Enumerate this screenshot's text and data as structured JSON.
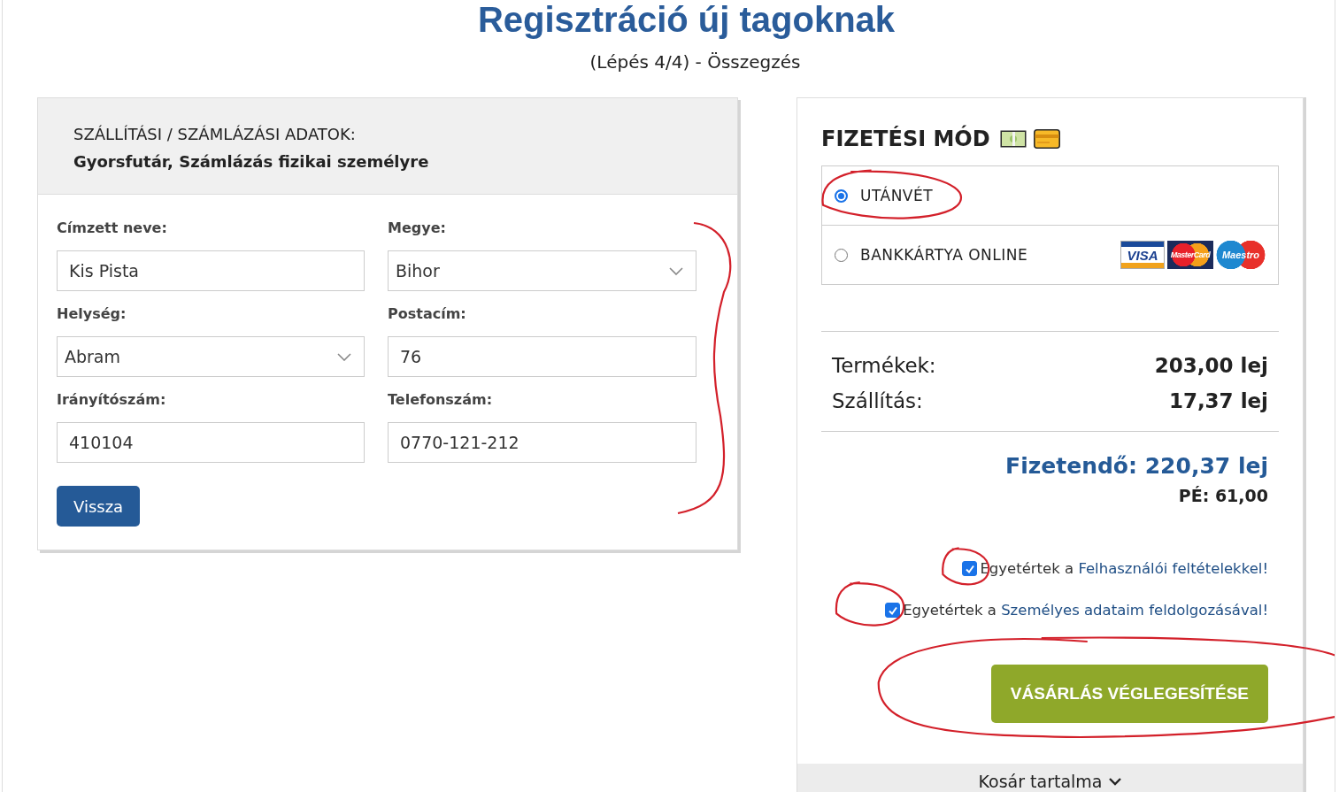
{
  "header": {
    "title": "Regisztráció új tagoknak",
    "subtitle": "(Lépés 4/4) - Összegzés"
  },
  "shipping": {
    "heading": "SZÁLLÍTÁSI / SZÁMLÁZÁSI ADATOK:",
    "summary": "Gyorsfutár, Számlázás fizikai személyre",
    "fields": [
      {
        "label": "Címzett neve:",
        "kind": "text",
        "value": "Kis Pista"
      },
      {
        "label": "Megye:",
        "kind": "select",
        "value": "Bihor"
      },
      {
        "label": "Helység:",
        "kind": "select",
        "value": "Abram"
      },
      {
        "label": "Postacím:",
        "kind": "text",
        "value": "76"
      },
      {
        "label": "Irányítószám:",
        "kind": "text",
        "value": "410104"
      },
      {
        "label": "Telefonszám:",
        "kind": "text",
        "value": "0770-121-212"
      }
    ],
    "back_button": "Vissza"
  },
  "payment": {
    "title": "FIZETÉSI MÓD",
    "methods": [
      {
        "label": "UTÁNVÉT",
        "selected": true
      },
      {
        "label": "BANKKÁRTYA ONLINE",
        "selected": false,
        "card_logos": [
          "VISA",
          "MasterCard",
          "Maestro"
        ]
      }
    ],
    "totals": [
      {
        "label": "Termékek:",
        "value": "203,00 lej"
      },
      {
        "label": "Szállítás:",
        "value": "17,37 lej"
      }
    ],
    "grand_total": "Fizetendő: 220,37 lej",
    "points": "PÉ: 61,00",
    "agreements": [
      {
        "text": "Egyetértek a ",
        "link": "Felhasználói feltételekkel!",
        "checked": true
      },
      {
        "text": "Egyetértek a ",
        "link": "Személyes adataim feldolgozásával!",
        "checked": true
      }
    ],
    "submit_button": "VÁSÁRLÁS VÉGLEGESÍTÉSE",
    "cart_toggle": "Kosár tartalma"
  }
}
